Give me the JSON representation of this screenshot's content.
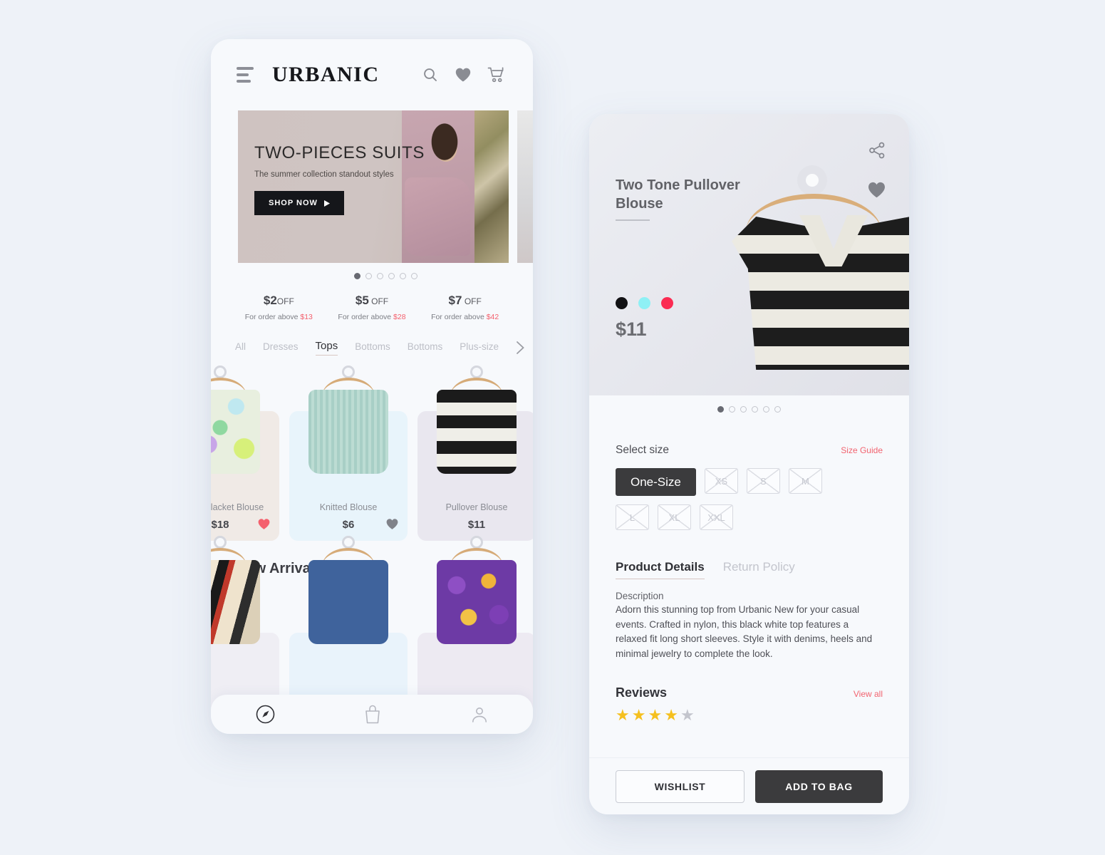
{
  "home": {
    "brand": "URBANIC",
    "header_icons": [
      "hamburger-icon",
      "search-icon",
      "heart-icon",
      "cart-icon"
    ],
    "hero": {
      "title": "TWO-PIECES SUITS",
      "subtitle": "The summer collection standout styles",
      "cta": "SHOP NOW",
      "dots_total": 6,
      "dots_active": 1
    },
    "offers": [
      {
        "amount": "$2",
        "off": "OFF",
        "sub_prefix": "For order above ",
        "sub_value": "$13"
      },
      {
        "amount": "$5",
        "off": "OFF",
        "sub_prefix": "For order above ",
        "sub_value": "$28"
      },
      {
        "amount": "$7",
        "off": "OFF",
        "sub_prefix": "For order above ",
        "sub_value": "$42"
      }
    ],
    "categories": [
      "All",
      "Dresses",
      "Tops",
      "Bottoms",
      "Bottoms",
      "Plus-size"
    ],
    "category_active": "Tops",
    "products": [
      {
        "name": "Button Placket Blouse",
        "price": "$18",
        "liked": true
      },
      {
        "name": "Knitted Blouse",
        "price": "$6",
        "liked": false
      },
      {
        "name": "Pullover Blouse",
        "price": "$11",
        "liked": false
      }
    ],
    "new_arrivals": {
      "title": "New Arrivals"
    },
    "bottom_nav": [
      "compass-icon",
      "bag-icon",
      "profile-icon"
    ]
  },
  "detail": {
    "title": "Two Tone Pullover Blouse",
    "price": "$11",
    "colors": [
      "#111114",
      "#8ef0f5",
      "#fb2b52"
    ],
    "dots_total": 6,
    "dots_active": 1,
    "size": {
      "label": "Select size",
      "guide_link": "Size Guide",
      "selected": "One-Size",
      "options": [
        "XS",
        "S",
        "M",
        "L",
        "XL",
        "XXL"
      ]
    },
    "tabs": {
      "active": "Product Details",
      "inactive": "Return Policy"
    },
    "description_label": "Description",
    "description": "Adorn this stunning top from Urbanic New for your casual events. Crafted in nylon, this black white top features a relaxed fit long short sleeves. Style it with denims, heels and minimal jewelry to complete the look.",
    "reviews": {
      "title": "Reviews",
      "view_all": "View all",
      "rating": 4,
      "max": 5
    },
    "buttons": {
      "wishlist": "WISHLIST",
      "add_to_bag": "ADD TO BAG"
    }
  },
  "colors": {
    "accent_red": "#f2636f",
    "dark": "#3b3b3d",
    "page_bg": "#eef2f8"
  }
}
